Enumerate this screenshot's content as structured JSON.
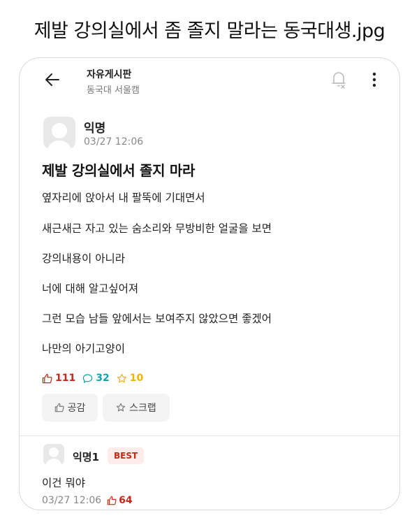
{
  "caption": "제발 강의실에서 좀 졸지 말라는 동국대생.jpg",
  "header": {
    "board_title": "자유게시판",
    "board_sub": "동국대 서울캠"
  },
  "post": {
    "author": "익명",
    "time": "03/27 12:06",
    "title": "제발 강의실에서 졸지 마라",
    "lines": [
      "옆자리에 앉아서 내 팔뚝에 기대면서",
      "새근새근 자고 있는 숨소리와 무방비한 얼굴을 보면",
      "강의내용이 아니라",
      "너에 대해 알고싶어져",
      "그런 모습 남들 앞에서는 보여주지 않았으면 좋겠어",
      "나만의 아기고양이"
    ],
    "likes": "111",
    "comments": "32",
    "scraps": "10",
    "like_button": "공감",
    "scrap_button": "스크랩"
  },
  "comment": {
    "author": "익명1",
    "badge": "BEST",
    "body": "이건 뭐야",
    "time": "03/27 12:06",
    "likes": "64"
  },
  "colors": {
    "like": "#c62917",
    "comment": "#0ca5b0",
    "scrap": "#f2b300"
  },
  "icons": [
    "back-arrow-icon",
    "bell-off-icon",
    "more-vertical-icon",
    "thumbs-up-icon",
    "comment-icon",
    "star-icon",
    "avatar-icon"
  ]
}
